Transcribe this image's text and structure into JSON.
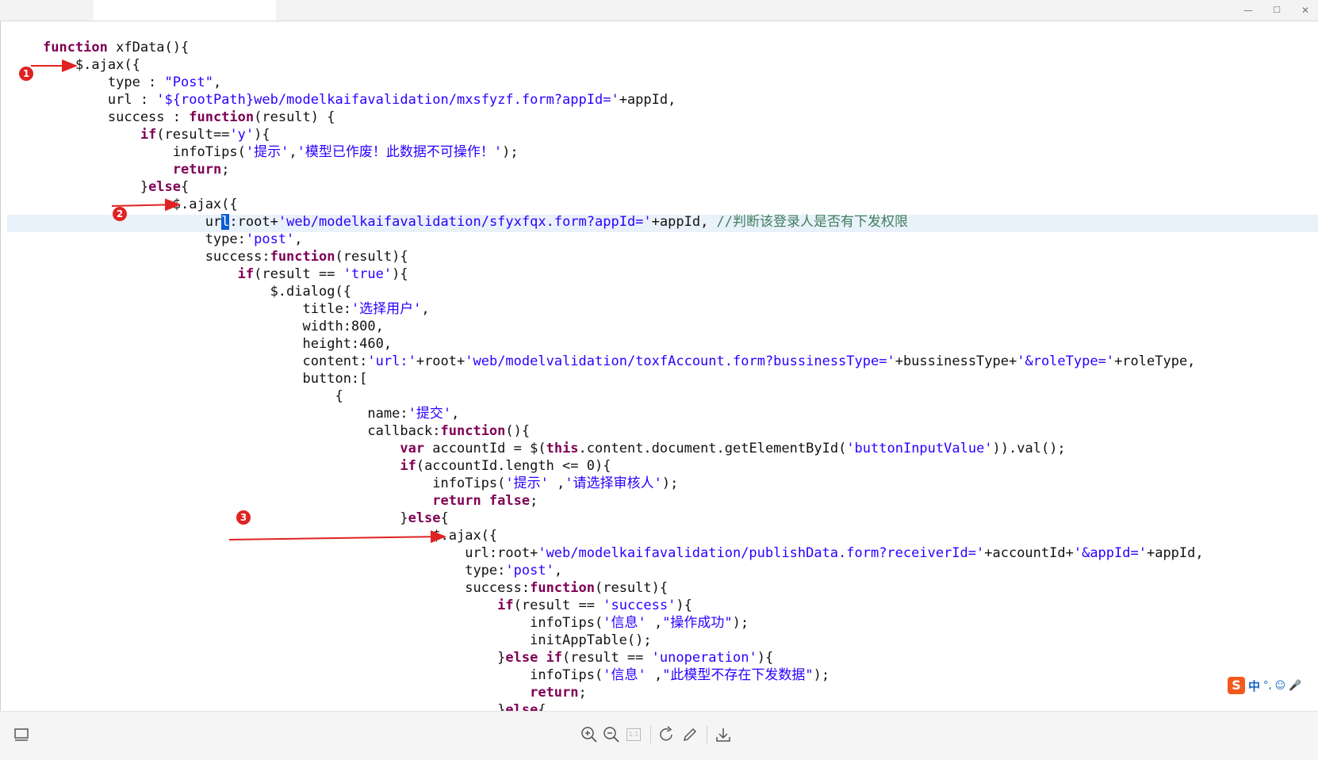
{
  "window": {
    "minimize_glyph": "—",
    "maximize_glyph": "☐",
    "close_glyph": "✕"
  },
  "code_lines": [
    [
      [
        "kw",
        "function"
      ],
      [
        "t",
        " xfData(){"
      ]
    ],
    [
      [
        "t",
        "    $.ajax({"
      ]
    ],
    [
      [
        "t",
        "        type : "
      ],
      [
        "str",
        "\"Post\""
      ],
      [
        "t",
        ","
      ]
    ],
    [
      [
        "t",
        "        url : "
      ],
      [
        "str",
        "'${rootPath}web/modelkaifavalidation/mxsfyzf.form?appId='"
      ],
      [
        "t",
        "+appId,"
      ]
    ],
    [
      [
        "t",
        "        success : "
      ],
      [
        "kw",
        "function"
      ],
      [
        "t",
        "(result) {"
      ]
    ],
    [
      [
        "t",
        "            "
      ],
      [
        "kw",
        "if"
      ],
      [
        "t",
        "(result=="
      ],
      [
        "str",
        "'y'"
      ],
      [
        "t",
        "){"
      ]
    ],
    [
      [
        "t",
        "                infoTips("
      ],
      [
        "str",
        "'提示'"
      ],
      [
        "t",
        ","
      ],
      [
        "str",
        "'模型已作废！此数据不可操作！'"
      ],
      [
        "t",
        ");"
      ]
    ],
    [
      [
        "t",
        "                "
      ],
      [
        "kw",
        "return"
      ],
      [
        "t",
        ";"
      ]
    ],
    [
      [
        "t",
        "            }"
      ],
      [
        "kw",
        "else"
      ],
      [
        "t",
        "{"
      ]
    ],
    [
      [
        "t",
        "                $.ajax({"
      ]
    ],
    [
      [
        "t",
        "                    ur"
      ],
      [
        "sel",
        "l"
      ],
      [
        "t",
        ":root+"
      ],
      [
        "str",
        "'web/modelkaifavalidation/sfyxfqx.form?appId='"
      ],
      [
        "t",
        "+appId, "
      ],
      [
        "cmt",
        "//判断该登录人是否有下发权限"
      ]
    ],
    [
      [
        "t",
        "                    type:"
      ],
      [
        "str",
        "'post'"
      ],
      [
        "t",
        ","
      ]
    ],
    [
      [
        "t",
        "                    success:"
      ],
      [
        "kw",
        "function"
      ],
      [
        "t",
        "(result){"
      ]
    ],
    [
      [
        "t",
        "                        "
      ],
      [
        "kw",
        "if"
      ],
      [
        "t",
        "(result == "
      ],
      [
        "str",
        "'true'"
      ],
      [
        "t",
        "){"
      ]
    ],
    [
      [
        "t",
        "                            $.dialog({"
      ]
    ],
    [
      [
        "t",
        "                                title:"
      ],
      [
        "str",
        "'选择用户'"
      ],
      [
        "t",
        ","
      ]
    ],
    [
      [
        "t",
        "                                width:800,"
      ]
    ],
    [
      [
        "t",
        "                                height:460,"
      ]
    ],
    [
      [
        "t",
        "                                content:"
      ],
      [
        "str",
        "'url:'"
      ],
      [
        "t",
        "+root+"
      ],
      [
        "str",
        "'web/modelvalidation/toxfAccount.form?bussinessType='"
      ],
      [
        "t",
        "+bussinessType+"
      ],
      [
        "str",
        "'&roleType='"
      ],
      [
        "t",
        "+roleType,"
      ]
    ],
    [
      [
        "t",
        "                                button:["
      ]
    ],
    [
      [
        "t",
        "                                    {"
      ]
    ],
    [
      [
        "t",
        "                                        name:"
      ],
      [
        "str",
        "'提交'"
      ],
      [
        "t",
        ","
      ]
    ],
    [
      [
        "t",
        "                                        callback:"
      ],
      [
        "kw",
        "function"
      ],
      [
        "t",
        "(){"
      ]
    ],
    [
      [
        "t",
        "                                            "
      ],
      [
        "kw",
        "var"
      ],
      [
        "t",
        " accountId = $("
      ],
      [
        "kw",
        "this"
      ],
      [
        "t",
        ".content.document.getElementById("
      ],
      [
        "str",
        "'buttonInputValue'"
      ],
      [
        "t",
        ")).val();"
      ]
    ],
    [
      [
        "t",
        "                                            "
      ],
      [
        "kw",
        "if"
      ],
      [
        "t",
        "(accountId.length <= 0){"
      ]
    ],
    [
      [
        "t",
        "                                                infoTips("
      ],
      [
        "str",
        "'提示'"
      ],
      [
        "t",
        " ,"
      ],
      [
        "str",
        "'请选择审核人'"
      ],
      [
        "t",
        ");"
      ]
    ],
    [
      [
        "t",
        "                                                "
      ],
      [
        "kw",
        "return false"
      ],
      [
        "t",
        ";"
      ]
    ],
    [
      [
        "t",
        "                                            }"
      ],
      [
        "kw",
        "else"
      ],
      [
        "t",
        "{"
      ]
    ],
    [
      [
        "t",
        "                                                $.ajax({"
      ]
    ],
    [
      [
        "t",
        "                                                    url:root+"
      ],
      [
        "str",
        "'web/modelkaifavalidation/publishData.form?receiverId='"
      ],
      [
        "t",
        "+accountId+"
      ],
      [
        "str",
        "'&appId='"
      ],
      [
        "t",
        "+appId,"
      ]
    ],
    [
      [
        "t",
        "                                                    type:"
      ],
      [
        "str",
        "'post'"
      ],
      [
        "t",
        ","
      ]
    ],
    [
      [
        "t",
        "                                                    success:"
      ],
      [
        "kw",
        "function"
      ],
      [
        "t",
        "(result){"
      ]
    ],
    [
      [
        "t",
        "                                                        "
      ],
      [
        "kw",
        "if"
      ],
      [
        "t",
        "(result == "
      ],
      [
        "str",
        "'success'"
      ],
      [
        "t",
        "){"
      ]
    ],
    [
      [
        "t",
        "                                                            infoTips("
      ],
      [
        "str",
        "'信息'"
      ],
      [
        "t",
        " ,"
      ],
      [
        "str",
        "\"操作成功\""
      ],
      [
        "t",
        ");"
      ]
    ],
    [
      [
        "t",
        "                                                            initAppTable();"
      ]
    ],
    [
      [
        "t",
        "                                                        }"
      ],
      [
        "kw",
        "else if"
      ],
      [
        "t",
        "(result == "
      ],
      [
        "str",
        "'unoperation'"
      ],
      [
        "t",
        "){"
      ]
    ],
    [
      [
        "t",
        "                                                            infoTips("
      ],
      [
        "str",
        "'信息'"
      ],
      [
        "t",
        " ,"
      ],
      [
        "str",
        "\"此模型不存在下发数据\""
      ],
      [
        "t",
        ");"
      ]
    ],
    [
      [
        "t",
        "                                                            "
      ],
      [
        "kw",
        "return"
      ],
      [
        "t",
        ";"
      ]
    ],
    [
      [
        "t",
        "                                                        }"
      ],
      [
        "kw",
        "else"
      ],
      [
        "t",
        "{"
      ]
    ]
  ],
  "annotations": [
    "1",
    "2",
    "3"
  ],
  "ime": {
    "logo": "S",
    "lang": "中",
    "punct": "°,",
    "emoji": "☺",
    "mic": "🎤"
  },
  "toolbar": {
    "icons": [
      "thumbnail-icon",
      "zoom-in-icon",
      "zoom-out-icon",
      "actual-size-icon",
      "rotate-icon",
      "edit-icon",
      "download-icon"
    ],
    "actual_size_label": "1:1"
  },
  "colors": {
    "keyword": "#7f0055",
    "string": "#2a00ff",
    "comment": "#3f7f5f",
    "annotation": "#e02222"
  }
}
